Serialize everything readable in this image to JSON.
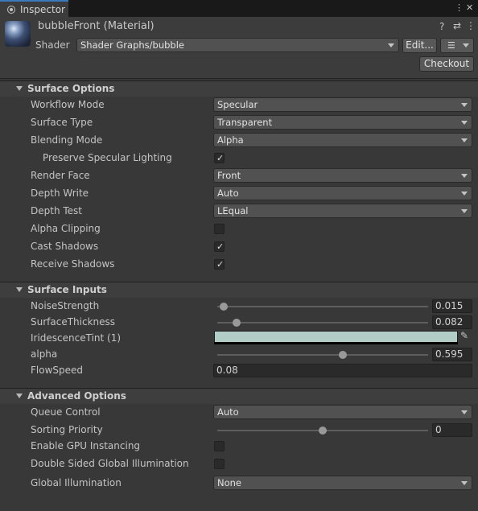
{
  "window": {
    "tab_label": "Inspector"
  },
  "header": {
    "title": "bubbleFront (Material)",
    "shader_label": "Shader",
    "shader_value": "Shader Graphs/bubble",
    "edit_label": "Edit...",
    "checkout_label": "Checkout"
  },
  "surface_options": {
    "title": "Surface Options",
    "workflow_mode": {
      "label": "Workflow Mode",
      "value": "Specular"
    },
    "surface_type": {
      "label": "Surface Type",
      "value": "Transparent"
    },
    "blending_mode": {
      "label": "Blending Mode",
      "value": "Alpha"
    },
    "preserve_specular": {
      "label": "Preserve Specular Lighting",
      "checked": true
    },
    "render_face": {
      "label": "Render Face",
      "value": "Front"
    },
    "depth_write": {
      "label": "Depth Write",
      "value": "Auto"
    },
    "depth_test": {
      "label": "Depth Test",
      "value": "LEqual"
    },
    "alpha_clipping": {
      "label": "Alpha Clipping",
      "checked": false
    },
    "cast_shadows": {
      "label": "Cast Shadows",
      "checked": true
    },
    "receive_shadows": {
      "label": "Receive Shadows",
      "checked": true
    }
  },
  "surface_inputs": {
    "title": "Surface Inputs",
    "noise_strength": {
      "label": "NoiseStrength",
      "value": "0.015",
      "fraction": 0.03
    },
    "surface_thickness": {
      "label": "SurfaceThickness",
      "value": "0.082",
      "fraction": 0.09
    },
    "iridescence_tint": {
      "label": "IridescenceTint (1)",
      "color": "#b2ccc6"
    },
    "alpha": {
      "label": "alpha",
      "value": "0.595",
      "fraction": 0.595
    },
    "flow_speed": {
      "label": "FlowSpeed",
      "value": "0.08"
    }
  },
  "advanced_options": {
    "title": "Advanced Options",
    "queue_control": {
      "label": "Queue Control",
      "value": "Auto"
    },
    "sorting_priority": {
      "label": "Sorting Priority",
      "value": "0",
      "fraction": 0.5
    },
    "gpu_instancing": {
      "label": "Enable GPU Instancing",
      "checked": false
    },
    "double_sided_gi": {
      "label": "Double Sided Global Illumination",
      "checked": false
    },
    "global_illumination": {
      "label": "Global Illumination",
      "value": "None"
    }
  },
  "colors": {
    "accent": "#3a79bb",
    "background": "#383838",
    "field": "#515151"
  }
}
